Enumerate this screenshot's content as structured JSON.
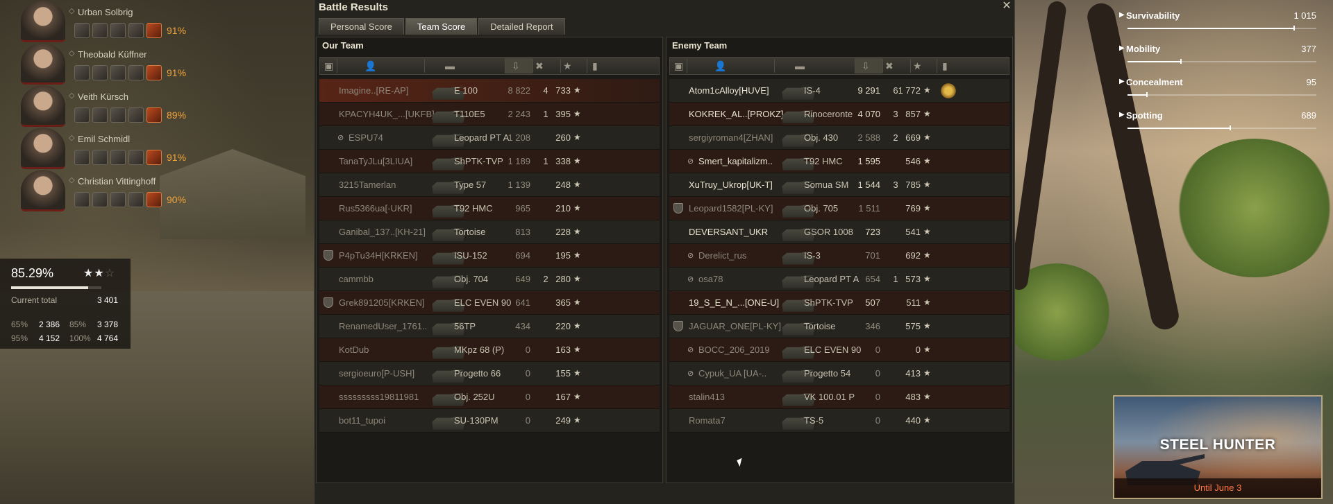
{
  "window": {
    "title": "Battle Results",
    "tabs": [
      "Personal Score",
      "Team Score",
      "Detailed Report"
    ],
    "active_tab": 1
  },
  "crew": [
    {
      "name": "Urban Solbrig",
      "pct": "91%"
    },
    {
      "name": "Theobald Küffner",
      "pct": "91%"
    },
    {
      "name": "Veith Kürsch",
      "pct": "89%"
    },
    {
      "name": "Emil Schmidl",
      "pct": "91%"
    },
    {
      "name": "Christian Vittinghoff",
      "pct": "90%"
    }
  ],
  "stats": {
    "percent": "85.29%",
    "stars": 2,
    "progress": 0.8529,
    "current_total_label": "Current total",
    "current_total": "3 401",
    "thresholds": [
      {
        "pct": "65%",
        "value": "2 386"
      },
      {
        "pct": "85%",
        "value": "3 378"
      },
      {
        "pct": "95%",
        "value": "4 152"
      },
      {
        "pct": "100%",
        "value": "4 764"
      }
    ]
  },
  "our_team": {
    "title": "Our Team",
    "players": [
      {
        "name": "Imagine..[RE-AP]",
        "tank": "E 100",
        "damage": "8 822",
        "kills": "4",
        "xp": "733",
        "alive": false,
        "highlight": true,
        "icon": "eye-slash-icon"
      },
      {
        "name": "KPACYH4UK_...[UKFB]",
        "tank": "T110E5",
        "damage": "2 243",
        "kills": "1",
        "xp": "395",
        "alive": false
      },
      {
        "name": "ESPU74",
        "tank": "Leopard PT A",
        "damage": "1 208",
        "kills": "",
        "xp": "260",
        "alive": false,
        "prefix_icon": "eye-slash-icon"
      },
      {
        "name": "TanaTyJLu[3LIUA]",
        "tank": "ShPTK-TVP",
        "damage": "1 189",
        "kills": "1",
        "xp": "338",
        "alive": false
      },
      {
        "name": "3215Tamerlan",
        "tank": "Type 57",
        "damage": "1 139",
        "kills": "",
        "xp": "248",
        "alive": false
      },
      {
        "name": "Rus5366ua[-UKR]",
        "tank": "T92 HMC",
        "damage": "965",
        "kills": "",
        "xp": "210",
        "alive": false
      },
      {
        "name": "Ganibal_137..[KH-21]",
        "tank": "Tortoise",
        "damage": "813",
        "kills": "",
        "xp": "228",
        "alive": false
      },
      {
        "name": "P4pTu34H[KRKEN]",
        "tank": "ISU-152",
        "damage": "694",
        "kills": "",
        "xp": "195",
        "alive": false,
        "platoon": true
      },
      {
        "name": "cammbb",
        "tank": "Obj. 704",
        "damage": "649",
        "kills": "2",
        "xp": "280",
        "alive": false
      },
      {
        "name": "Grek891205[KRKEN]",
        "tank": "ELC EVEN 90",
        "damage": "641",
        "kills": "",
        "xp": "365",
        "alive": false,
        "platoon": true
      },
      {
        "name": "RenamedUser_1761..",
        "tank": "56TP",
        "damage": "434",
        "kills": "",
        "xp": "220",
        "alive": false
      },
      {
        "name": "KotDub",
        "tank": "MKpz 68 (P)",
        "damage": "0",
        "kills": "",
        "xp": "163",
        "alive": false
      },
      {
        "name": "sergioeuro[P-USH]",
        "tank": "Progetto 66",
        "damage": "0",
        "kills": "",
        "xp": "155",
        "alive": false
      },
      {
        "name": "sssssssss19811981",
        "tank": "Obj. 252U",
        "damage": "0",
        "kills": "",
        "xp": "167",
        "alive": false
      },
      {
        "name": "bot11_tupoi",
        "tank": "SU-130PM",
        "damage": "0",
        "kills": "",
        "xp": "249",
        "alive": false
      }
    ]
  },
  "enemy_team": {
    "title": "Enemy Team",
    "players": [
      {
        "name": "Atom1cAlloy[HUVE]",
        "tank": "IS-4",
        "damage": "9 291",
        "kills": "6",
        "xp": "1 772",
        "alive": true,
        "medal": true
      },
      {
        "name": "KOKREK_AL..[PROKZ]",
        "tank": "Rinoceronte",
        "damage": "4 070",
        "kills": "3",
        "xp": "857",
        "alive": true
      },
      {
        "name": "sergiyroman4[ZHAN]",
        "tank": "Obj. 430",
        "damage": "2 588",
        "kills": "2",
        "xp": "669",
        "alive": false
      },
      {
        "name": "Smert_kapitalizm..",
        "tank": "T92 HMC",
        "damage": "1 595",
        "kills": "",
        "xp": "546",
        "alive": true,
        "prefix_icon": "eye-slash-icon"
      },
      {
        "name": "XuTruy_Ukrop[UK-T]",
        "tank": "Somua SM",
        "damage": "1 544",
        "kills": "3",
        "xp": "785",
        "alive": true
      },
      {
        "name": "Leopard1582[PL-KY]",
        "tank": "Obj. 705",
        "damage": "1 511",
        "kills": "",
        "xp": "769",
        "alive": false,
        "platoon": true
      },
      {
        "name": "DEVERSANT_UKR",
        "tank": "GSOR 1008",
        "damage": "723",
        "kills": "",
        "xp": "541",
        "alive": true
      },
      {
        "name": "Derelict_rus",
        "tank": "IS-3",
        "damage": "701",
        "kills": "",
        "xp": "692",
        "alive": false,
        "prefix_icon": "eye-slash-icon"
      },
      {
        "name": "osa78",
        "tank": "Leopard PT A",
        "damage": "654",
        "kills": "1",
        "xp": "573",
        "alive": false,
        "prefix_icon": "eye-slash-icon"
      },
      {
        "name": "19_S_E_N_...[ONE-U]",
        "tank": "ShPTK-TVP",
        "damage": "507",
        "kills": "",
        "xp": "511",
        "alive": true
      },
      {
        "name": "JAGUAR_ONE[PL-KY]",
        "tank": "Tortoise",
        "damage": "346",
        "kills": "",
        "xp": "575",
        "alive": false,
        "platoon": true
      },
      {
        "name": "BOCC_206_2019",
        "tank": "ELC EVEN 90",
        "damage": "0",
        "kills": "",
        "xp": "0",
        "alive": false,
        "prefix_icon": "eye-slash-icon"
      },
      {
        "name": "Cypuk_UA [UA-..",
        "tank": "Progetto 54",
        "damage": "0",
        "kills": "",
        "xp": "413",
        "alive": false,
        "prefix_icon": "eye-slash-icon"
      },
      {
        "name": "stalin413",
        "tank": "VK 100.01 P",
        "damage": "0",
        "kills": "",
        "xp": "483",
        "alive": false
      },
      {
        "name": "Romata7",
        "tank": "TS-5",
        "damage": "0",
        "kills": "",
        "xp": "440",
        "alive": false
      }
    ]
  },
  "params": [
    {
      "label": "Survivability",
      "value": "1 015",
      "fill": 0.88
    },
    {
      "label": "Mobility",
      "value": "377",
      "fill": 0.28
    },
    {
      "label": "Concealment",
      "value": "95",
      "fill": 0.1
    },
    {
      "label": "Spotting",
      "value": "689",
      "fill": 0.54
    }
  ],
  "banner": {
    "title": "STEEL HUNTER",
    "subtitle": "Until June 3"
  },
  "colors": {
    "accent_orange": "#f2a43a",
    "banner_sub": "#ff7a45",
    "highlight_row": "#622616"
  }
}
